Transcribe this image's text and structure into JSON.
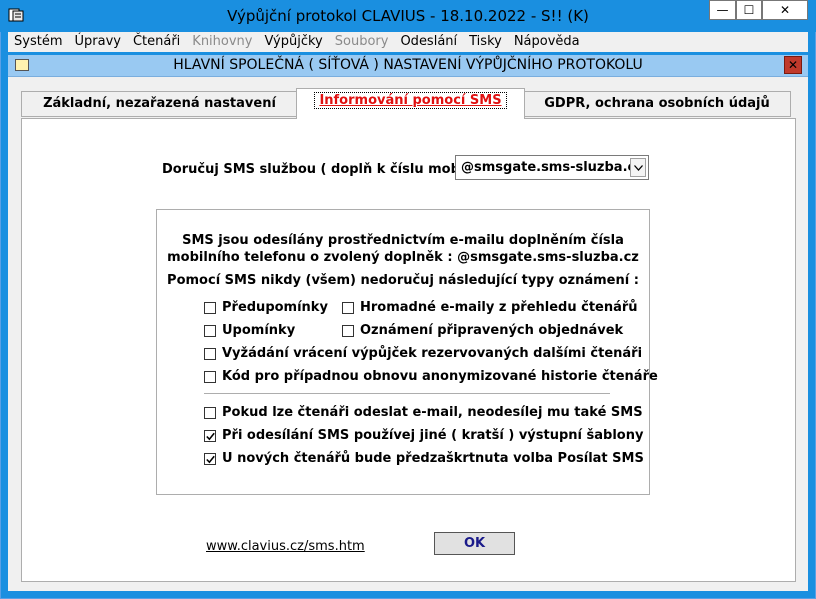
{
  "window": {
    "title": "Výpůjční protokol CLAVIUS - 18.10.2022 - S!! (K)",
    "buttons": {
      "minimize": "—",
      "maximize": "☐",
      "close": "✕"
    }
  },
  "menu": [
    {
      "label": "Systém",
      "enabled": true
    },
    {
      "label": "Úpravy",
      "enabled": true
    },
    {
      "label": "Čtenáři",
      "enabled": true
    },
    {
      "label": "Knihovny",
      "enabled": false
    },
    {
      "label": "Výpůjčky",
      "enabled": true
    },
    {
      "label": "Soubory",
      "enabled": false
    },
    {
      "label": "Odeslání",
      "enabled": true
    },
    {
      "label": "Tisky",
      "enabled": true
    },
    {
      "label": "Nápověda",
      "enabled": true
    }
  ],
  "dialog": {
    "title": "HLAVNÍ SPOLEČNÁ ( SÍŤOVÁ ) NASTAVENÍ VÝPŮJČNÍHO PROTOKOLU",
    "close_label": "✕"
  },
  "tabs": [
    {
      "label": "Základní, nezařazená nastavení",
      "active": false
    },
    {
      "label": "Informování pomocí SMS",
      "active": true
    },
    {
      "label": "GDPR, ochrana osobních údajů",
      "active": false
    }
  ],
  "sms": {
    "deliver_label": "Doručuj SMS službou ( doplň k číslu mobilu ) :",
    "service_value": "@smsgate.sms-sluzba.cz",
    "info_line1": "SMS jsou odesílány prostřednictvím e-mailu doplněním čísla",
    "info_line2": "mobilního telefonu o zvolený doplněk : @smsgate.sms-sluzba.cz",
    "never_heading": "Pomocí SMS nikdy (všem) nedoručuj následující typy oznámení :",
    "never_types": {
      "predupominky": {
        "label": "Předupomínky",
        "checked": false
      },
      "hromadne": {
        "label": "Hromadné e-maily z přehledu čtenářů",
        "checked": false
      },
      "upominky": {
        "label": "Upomínky",
        "checked": false
      },
      "objednavky": {
        "label": "Oznámení připravených objednávek",
        "checked": false
      },
      "vyzadani": {
        "label": "Vyžádání vrácení výpůjček rezervovaných dalšími čtenáři",
        "checked": false
      },
      "kod": {
        "label": "Kód pro případnou obnovu anonymizované historie čtenáře",
        "checked": false
      }
    },
    "options": {
      "no_sms_if_email": {
        "label": "Pokud lze čtenáři odeslat e-mail, neodesílej mu také SMS",
        "checked": false
      },
      "short_templates": {
        "label": "Při odesílání SMS používej jiné ( kratší ) výstupní šablony",
        "checked": true
      },
      "preselect_new": {
        "label": "U nových čtenářů bude předzaškrtnuta volba Posílat SMS",
        "checked": true
      }
    }
  },
  "footer": {
    "link": "www.clavius.cz/sms.htm",
    "ok": "OK"
  },
  "colors": {
    "titlebar": "#1a8fe0",
    "dialog_title": "#99c9f2",
    "active_tab_text": "#e01010",
    "ok_text": "#1a1a8a"
  }
}
